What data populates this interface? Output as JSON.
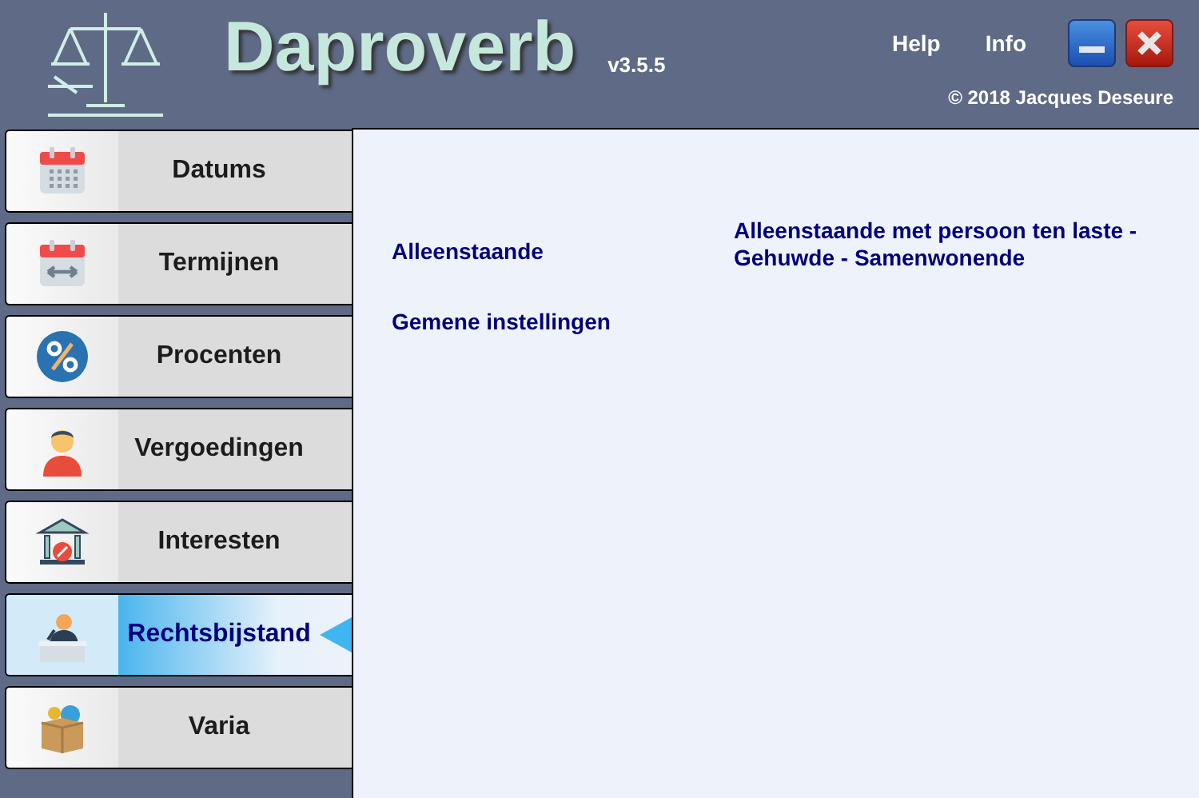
{
  "header": {
    "title": "Daproverb",
    "version": "v3.5.5",
    "links": [
      "Help",
      "Info"
    ],
    "copyright": "© 2018 Jacques Deseure"
  },
  "sidebar": {
    "items": [
      {
        "label": "Datums",
        "selected": false
      },
      {
        "label": "Termijnen",
        "selected": false
      },
      {
        "label": "Procenten",
        "selected": false
      },
      {
        "label": "Vergoedingen",
        "selected": false
      },
      {
        "label": "Interesten",
        "selected": false
      },
      {
        "label": "Rechtsbijstand",
        "selected": true
      },
      {
        "label": "Varia",
        "selected": false
      }
    ]
  },
  "content": {
    "left_links": [
      "Alleenstaande",
      "Gemene instellingen"
    ],
    "right_links": [
      "Alleenstaande met persoon ten laste - Gehuwde - Samenwonende"
    ]
  }
}
